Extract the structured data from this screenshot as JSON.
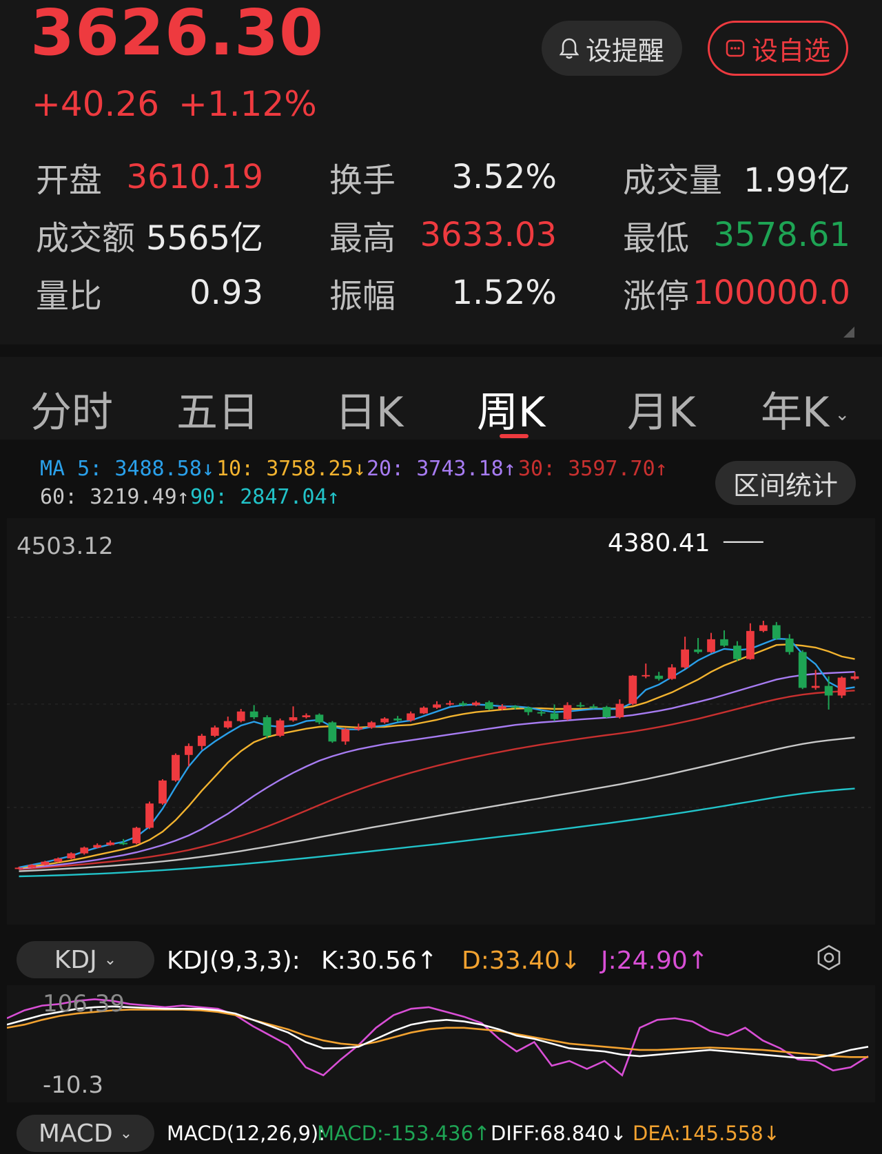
{
  "quote": {
    "price": "3626.30",
    "change": "+40.26",
    "change_pct": "+1.12%"
  },
  "buttons": {
    "remind_label": "设提醒",
    "fav_label": "设自选"
  },
  "stats": [
    {
      "label": "开盘",
      "value": "3610.19",
      "color": "red"
    },
    {
      "label": "换手",
      "value": "3.52%",
      "color": "white"
    },
    {
      "label": "成交量",
      "value": "1.99亿",
      "color": "white"
    },
    {
      "label": "成交额",
      "value": "5565亿",
      "color": "white"
    },
    {
      "label": "最高",
      "value": "3633.03",
      "color": "red"
    },
    {
      "label": "最低",
      "value": "3578.61",
      "color": "green"
    },
    {
      "label": "量比",
      "value": "0.93",
      "color": "white"
    },
    {
      "label": "振幅",
      "value": "1.52%",
      "color": "white"
    },
    {
      "label": "涨停",
      "value": "100000.0",
      "color": "red"
    }
  ],
  "tabs": [
    {
      "label": "分时"
    },
    {
      "label": "五日"
    },
    {
      "label": "日K"
    },
    {
      "label": "周K",
      "active": true
    },
    {
      "label": "月K"
    },
    {
      "label": "年K"
    }
  ],
  "ma": {
    "ma5": "MA 5: 3488.58↓",
    "ma10": "10: 3758.25↓",
    "ma20": "20: 3743.18↑",
    "ma30": "30: 3597.70↑",
    "ma60": "60: 3219.49↑",
    "ma90": "90: 2847.04↑"
  },
  "colors": {
    "up": "#ee3a3f",
    "down": "#1ea454",
    "ma5": "#2aa0ea",
    "ma10": "#f2b32f",
    "ma20": "#a77cf2",
    "ma30": "#c8302f",
    "ma60": "#c8c8c8",
    "ma90": "#22c3c9",
    "kdj_k": "#ffffff",
    "kdj_d": "#f2a230",
    "kdj_j": "#d94fd6"
  },
  "range_button": "区间统计",
  "chart_labels": {
    "y_top": "4503.12",
    "high_marker": "4380.41",
    "kdj_top": "106.39",
    "kdj_bottom": "-10.3"
  },
  "kdj": {
    "selector": "KDJ",
    "params": "KDJ(9,3,3):",
    "k": "K:30.56↑",
    "d": "D:33.40↓",
    "j": "J:24.90↑"
  },
  "macd": {
    "selector": "MACD",
    "params": "MACD(12,26,9):",
    "macd": "MACD:-153.436↑",
    "diff": "DIFF:68.840↓",
    "dea": "DEA:145.558↓"
  },
  "chart_data": {
    "type": "candlestick",
    "period": "weekly",
    "ylim": [
      1700,
      4503.12
    ],
    "high_label": 4380.41,
    "candles": [
      {
        "o": 1760,
        "c": 1768,
        "h": 1775,
        "l": 1755
      },
      {
        "o": 1768,
        "c": 1790,
        "h": 1795,
        "l": 1765
      },
      {
        "o": 1790,
        "c": 1815,
        "h": 1822,
        "l": 1785
      },
      {
        "o": 1815,
        "c": 1840,
        "h": 1848,
        "l": 1808
      },
      {
        "o": 1840,
        "c": 1880,
        "h": 1888,
        "l": 1834
      },
      {
        "o": 1880,
        "c": 1925,
        "h": 1933,
        "l": 1870
      },
      {
        "o": 1925,
        "c": 1945,
        "h": 1958,
        "l": 1920
      },
      {
        "o": 1945,
        "c": 1965,
        "h": 1980,
        "l": 1940
      },
      {
        "o": 1962,
        "c": 1958,
        "h": 1992,
        "l": 1945
      },
      {
        "o": 1958,
        "c": 2080,
        "h": 2088,
        "l": 1952
      },
      {
        "o": 2080,
        "c": 2270,
        "h": 2285,
        "l": 2070
      },
      {
        "o": 2270,
        "c": 2450,
        "h": 2460,
        "l": 2260
      },
      {
        "o": 2450,
        "c": 2650,
        "h": 2662,
        "l": 2440
      },
      {
        "o": 2650,
        "c": 2720,
        "h": 2740,
        "l": 2560
      },
      {
        "o": 2720,
        "c": 2800,
        "h": 2815,
        "l": 2690
      },
      {
        "o": 2800,
        "c": 2865,
        "h": 2880,
        "l": 2790
      },
      {
        "o": 2865,
        "c": 2915,
        "h": 2950,
        "l": 2855
      },
      {
        "o": 2915,
        "c": 2990,
        "h": 3010,
        "l": 2905
      },
      {
        "o": 2990,
        "c": 2945,
        "h": 3040,
        "l": 2930
      },
      {
        "o": 2945,
        "c": 2800,
        "h": 2960,
        "l": 2780
      },
      {
        "o": 2800,
        "c": 2920,
        "h": 2935,
        "l": 2790
      },
      {
        "o": 2920,
        "c": 2945,
        "h": 3030,
        "l": 2910
      },
      {
        "o": 2945,
        "c": 2960,
        "h": 2975,
        "l": 2935
      },
      {
        "o": 2965,
        "c": 2905,
        "h": 2975,
        "l": 2890
      },
      {
        "o": 2905,
        "c": 2755,
        "h": 2915,
        "l": 2745
      },
      {
        "o": 2755,
        "c": 2850,
        "h": 2860,
        "l": 2730
      },
      {
        "o": 2850,
        "c": 2865,
        "h": 2895,
        "l": 2840
      },
      {
        "o": 2865,
        "c": 2905,
        "h": 2915,
        "l": 2855
      },
      {
        "o": 2905,
        "c": 2935,
        "h": 2945,
        "l": 2895
      },
      {
        "o": 2935,
        "c": 2920,
        "h": 2955,
        "l": 2910
      },
      {
        "o": 2920,
        "c": 2975,
        "h": 2990,
        "l": 2910
      },
      {
        "o": 2975,
        "c": 3020,
        "h": 3030,
        "l": 2970
      },
      {
        "o": 3020,
        "c": 3045,
        "h": 3070,
        "l": 3010
      },
      {
        "o": 3045,
        "c": 3055,
        "h": 3075,
        "l": 3035
      },
      {
        "o": 3055,
        "c": 3040,
        "h": 3070,
        "l": 3030
      },
      {
        "o": 3040,
        "c": 3060,
        "h": 3072,
        "l": 3032
      },
      {
        "o": 3062,
        "c": 3010,
        "h": 3075,
        "l": 3000
      },
      {
        "o": 3010,
        "c": 3030,
        "h": 3048,
        "l": 2998
      },
      {
        "o": 3030,
        "c": 3020,
        "h": 3040,
        "l": 3005
      },
      {
        "o": 3020,
        "c": 2985,
        "h": 3030,
        "l": 2960
      },
      {
        "o": 2985,
        "c": 2975,
        "h": 3000,
        "l": 2955
      },
      {
        "o": 2975,
        "c": 2930,
        "h": 3045,
        "l": 2915
      },
      {
        "o": 2930,
        "c": 3040,
        "h": 3062,
        "l": 2920
      },
      {
        "o": 3040,
        "c": 3030,
        "h": 3062,
        "l": 3020
      },
      {
        "o": 3030,
        "c": 3025,
        "h": 3045,
        "l": 3012
      },
      {
        "o": 3025,
        "c": 2945,
        "h": 3035,
        "l": 2940
      },
      {
        "o": 2945,
        "c": 3050,
        "h": 3085,
        "l": 2935
      },
      {
        "o": 3050,
        "c": 3270,
        "h": 3275,
        "l": 3040
      },
      {
        "o": 3270,
        "c": 3275,
        "h": 3365,
        "l": 3250
      },
      {
        "o": 3270,
        "c": 3245,
        "h": 3300,
        "l": 3232
      },
      {
        "o": 3245,
        "c": 3335,
        "h": 3360,
        "l": 3238
      },
      {
        "o": 3335,
        "c": 3475,
        "h": 3575,
        "l": 3325
      },
      {
        "o": 3475,
        "c": 3455,
        "h": 3565,
        "l": 3442
      },
      {
        "o": 3455,
        "c": 3555,
        "h": 3605,
        "l": 3448
      },
      {
        "o": 3555,
        "c": 3505,
        "h": 3625,
        "l": 3495
      },
      {
        "o": 3505,
        "c": 3400,
        "h": 3540,
        "l": 3385
      },
      {
        "o": 3400,
        "c": 3620,
        "h": 3680,
        "l": 3395
      },
      {
        "o": 3620,
        "c": 3665,
        "h": 3700,
        "l": 3610
      },
      {
        "o": 3665,
        "c": 3560,
        "h": 3690,
        "l": 3550
      },
      {
        "o": 3560,
        "c": 3455,
        "h": 3595,
        "l": 3435
      },
      {
        "o": 3455,
        "c": 3175,
        "h": 3470,
        "l": 3165
      },
      {
        "o": 3175,
        "c": 3190,
        "h": 3315,
        "l": 3160
      },
      {
        "o": 3190,
        "c": 3115,
        "h": 3265,
        "l": 3005
      },
      {
        "o": 3115,
        "c": 3255,
        "h": 3265,
        "l": 3095
      },
      {
        "o": 3245,
        "c": 3265,
        "h": 3300,
        "l": 3235
      }
    ],
    "ma5": [
      1770,
      1790,
      1810,
      1835,
      1860,
      1895,
      1925,
      1950,
      1970,
      2010,
      2090,
      2230,
      2400,
      2560,
      2680,
      2755,
      2820,
      2880,
      2910,
      2880,
      2870,
      2880,
      2915,
      2925,
      2870,
      2850,
      2850,
      2870,
      2880,
      2905,
      2920,
      2955,
      2990,
      3025,
      3040,
      3045,
      3040,
      3030,
      3030,
      3020,
      3000,
      2985,
      2990,
      3000,
      3010,
      3010,
      3010,
      3060,
      3160,
      3200,
      3260,
      3320,
      3390,
      3440,
      3480,
      3470,
      3480,
      3520,
      3560,
      3555,
      3440,
      3360,
      3220,
      3165,
      3180
    ],
    "ma10": [
      1765,
      1778,
      1792,
      1808,
      1825,
      1845,
      1868,
      1890,
      1912,
      1940,
      1985,
      2050,
      2140,
      2250,
      2370,
      2480,
      2590,
      2680,
      2750,
      2790,
      2815,
      2835,
      2855,
      2870,
      2875,
      2870,
      2865,
      2870,
      2870,
      2880,
      2885,
      2905,
      2925,
      2950,
      2970,
      2985,
      2995,
      3005,
      3012,
      3015,
      3015,
      3010,
      3010,
      3010,
      3012,
      3012,
      3015,
      3030,
      3060,
      3100,
      3140,
      3190,
      3240,
      3300,
      3350,
      3390,
      3430,
      3470,
      3510,
      3515,
      3505,
      3490,
      3460,
      3420,
      3400
    ],
    "ma20": [
      1760,
      1770,
      1780,
      1790,
      1802,
      1815,
      1830,
      1848,
      1866,
      1888,
      1915,
      1945,
      1980,
      2020,
      2070,
      2130,
      2190,
      2260,
      2330,
      2395,
      2455,
      2510,
      2560,
      2605,
      2640,
      2670,
      2695,
      2715,
      2735,
      2750,
      2765,
      2780,
      2795,
      2810,
      2825,
      2840,
      2855,
      2870,
      2885,
      2895,
      2905,
      2912,
      2920,
      2928,
      2935,
      2942,
      2950,
      2962,
      2978,
      2995,
      3015,
      3040,
      3065,
      3090,
      3120,
      3150,
      3180,
      3210,
      3240,
      3260,
      3275,
      3285,
      3290,
      3295,
      3300
    ],
    "ma30": [
      1755,
      1762,
      1770,
      1778,
      1786,
      1795,
      1805,
      1815,
      1826,
      1838,
      1852,
      1868,
      1886,
      1906,
      1930,
      1956,
      1985,
      2017,
      2052,
      2090,
      2130,
      2172,
      2215,
      2258,
      2300,
      2340,
      2378,
      2414,
      2448,
      2480,
      2510,
      2538,
      2565,
      2590,
      2614,
      2636,
      2657,
      2677,
      2696,
      2714,
      2731,
      2747,
      2762,
      2777,
      2791,
      2805,
      2818,
      2833,
      2850,
      2868,
      2888,
      2910,
      2933,
      2958,
      2984,
      3010,
      3036,
      3062,
      3086,
      3106,
      3122,
      3134,
      3142,
      3148,
      3154
    ],
    "ma60": [
      1740,
      1745,
      1750,
      1756,
      1762,
      1768,
      1775,
      1782,
      1790,
      1798,
      1807,
      1817,
      1828,
      1840,
      1853,
      1867,
      1882,
      1898,
      1915,
      1932,
      1950,
      1968,
      1987,
      2006,
      2025,
      2044,
      2063,
      2082,
      2100,
      2118,
      2136,
      2154,
      2172,
      2190,
      2208,
      2225,
      2243,
      2260,
      2278,
      2295,
      2312,
      2330,
      2348,
      2366,
      2384,
      2402,
      2420,
      2440,
      2460,
      2482,
      2504,
      2527,
      2550,
      2574,
      2598,
      2622,
      2646,
      2670,
      2694,
      2716,
      2736,
      2752,
      2765,
      2776,
      2786
    ],
    "ma90": [
      1700,
      1702,
      1705,
      1708,
      1712,
      1716,
      1720,
      1725,
      1730,
      1736,
      1742,
      1748,
      1755,
      1762,
      1770,
      1778,
      1786,
      1795,
      1804,
      1813,
      1823,
      1833,
      1843,
      1853,
      1864,
      1875,
      1886,
      1897,
      1908,
      1919,
      1930,
      1941,
      1952,
      1964,
      1976,
      1988,
      2000,
      2012,
      2024,
      2036,
      2049,
      2062,
      2075,
      2088,
      2101,
      2114,
      2128,
      2142,
      2156,
      2171,
      2186,
      2202,
      2218,
      2234,
      2251,
      2268,
      2285,
      2302,
      2319,
      2334,
      2348,
      2360,
      2370,
      2379,
      2387
    ],
    "kdj_ylim": [
      -10.3,
      106.39
    ],
    "kdj_k": [
      74,
      80,
      86,
      90,
      94,
      96,
      97,
      96,
      95,
      94,
      94,
      94,
      92,
      88,
      80,
      72,
      64,
      52,
      44,
      44,
      46,
      56,
      66,
      74,
      78,
      80,
      78,
      74,
      68,
      60,
      56,
      50,
      44,
      42,
      40,
      36,
      34,
      36,
      38,
      40,
      42,
      40,
      38,
      36,
      34,
      32,
      32,
      36,
      42,
      46
    ],
    "kdj_d": [
      70,
      74,
      80,
      85,
      88,
      90,
      92,
      93,
      93,
      93,
      93,
      92,
      90,
      86,
      80,
      74,
      68,
      60,
      54,
      50,
      48,
      52,
      58,
      64,
      68,
      70,
      70,
      68,
      66,
      62,
      58,
      54,
      50,
      48,
      46,
      44,
      42,
      42,
      43,
      44,
      45,
      44,
      43,
      42,
      40,
      38,
      36,
      34,
      33,
      33
    ],
    "kdj_j": [
      82,
      92,
      98,
      100,
      104,
      106,
      104,
      100,
      98,
      96,
      98,
      96,
      94,
      86,
      72,
      60,
      48,
      20,
      10,
      30,
      48,
      70,
      86,
      94,
      96,
      90,
      84,
      76,
      56,
      40,
      52,
      22,
      28,
      18,
      28,
      10,
      70,
      80,
      82,
      78,
      66,
      60,
      70,
      54,
      44,
      30,
      28,
      16,
      20,
      34
    ]
  }
}
